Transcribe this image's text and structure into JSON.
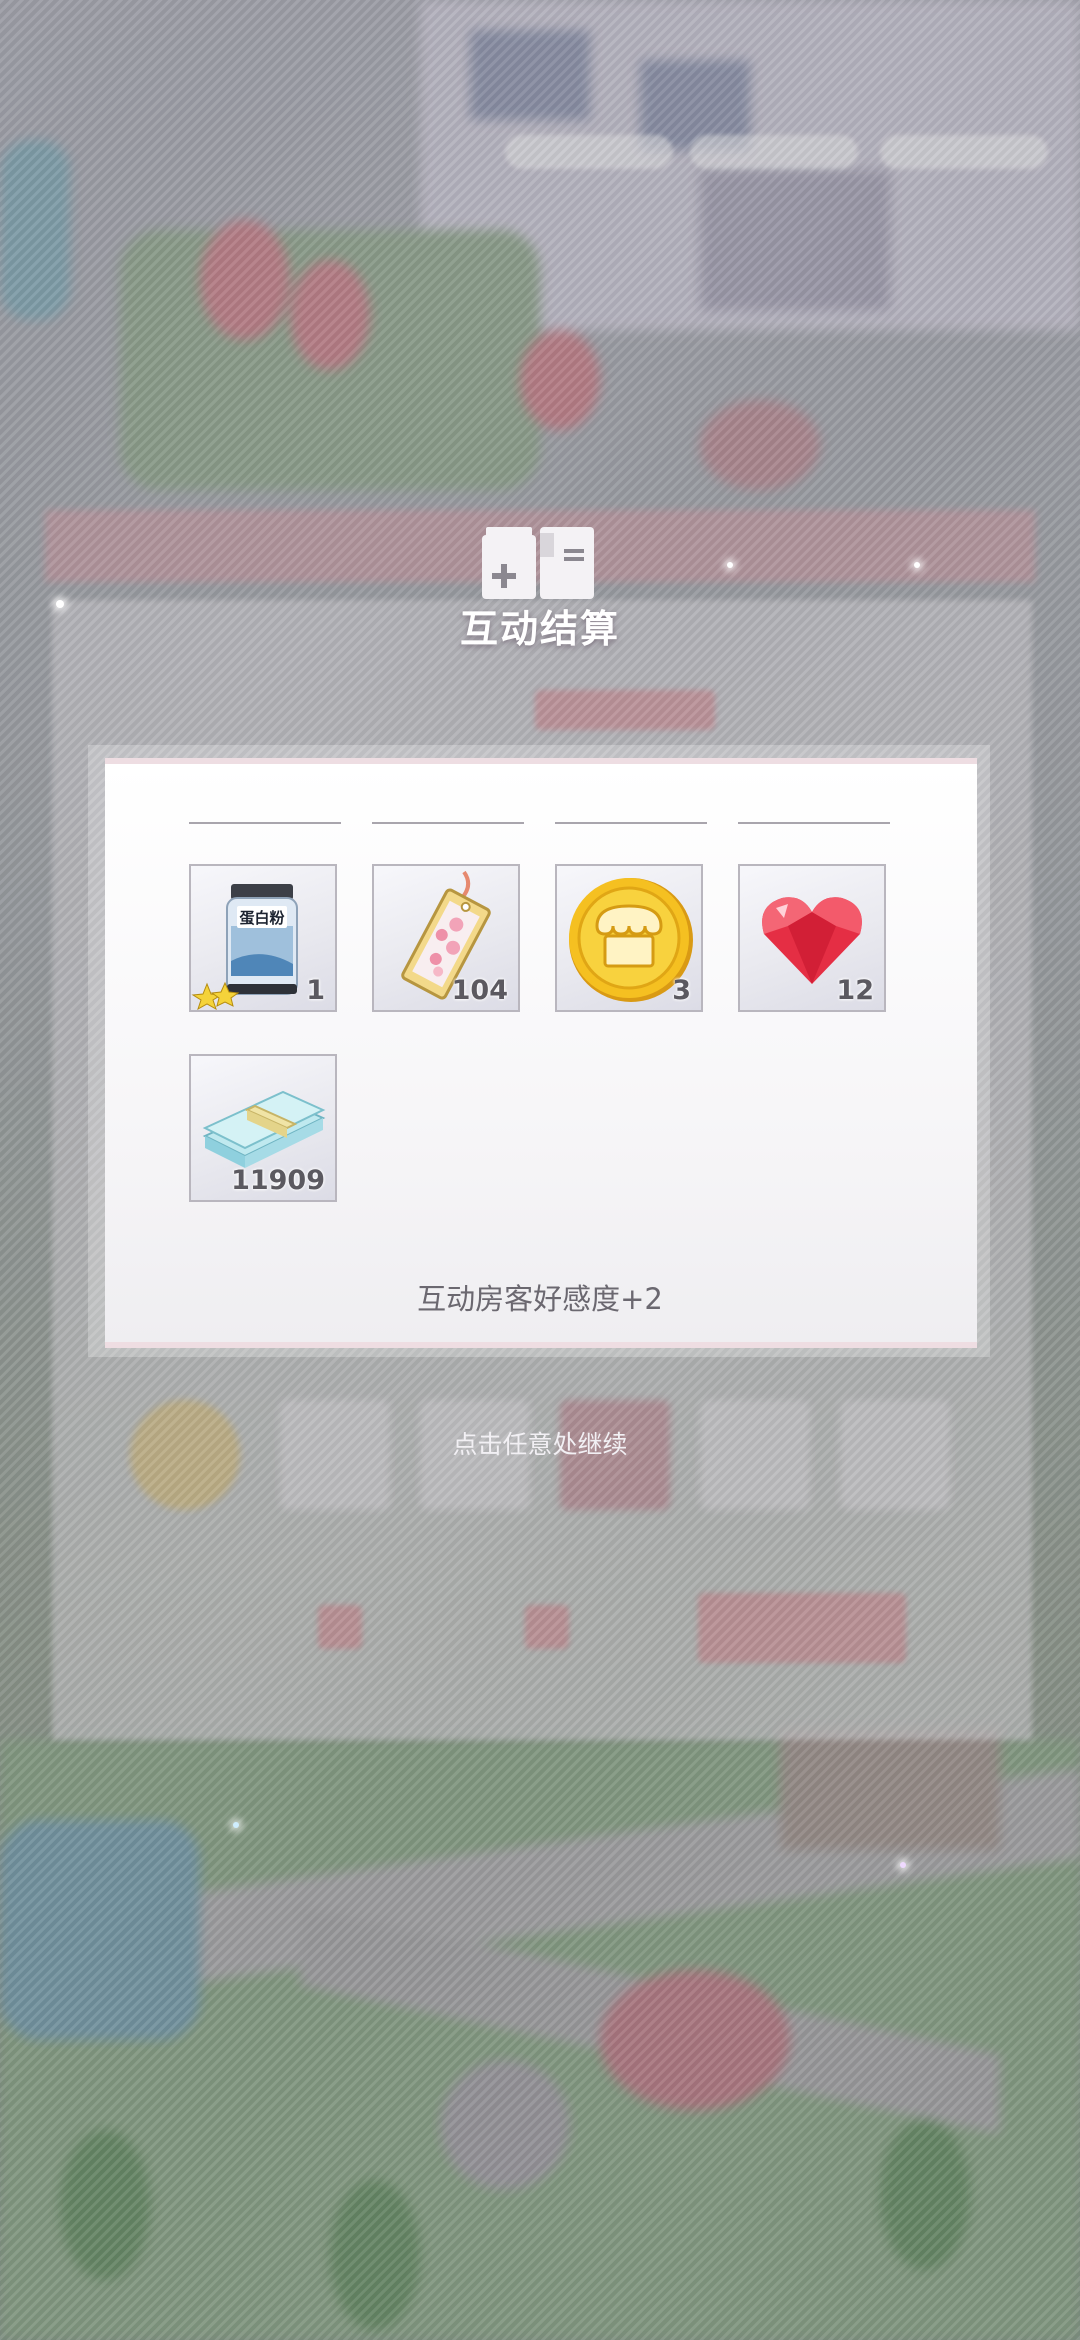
{
  "popup": {
    "title": "互动结算",
    "affinity_text": "互动房客好感度+2",
    "continue_hint": "点击任意处继续"
  },
  "rewards": [
    {
      "name": "protein-powder",
      "jar_label": "蛋白粉",
      "quantity": "1",
      "rarity_stars": 2
    },
    {
      "name": "sakura-bookmark",
      "quantity": "104"
    },
    {
      "name": "gold-shop-coin",
      "quantity": "3"
    },
    {
      "name": "red-heart-gem",
      "quantity": "12"
    },
    {
      "name": "cash-stack",
      "quantity": "11909"
    }
  ],
  "colors": {
    "title_text": "#ffffff",
    "qty_text": "#5b5960",
    "affinity_text": "#6b6870",
    "popup_border": "#eedde2"
  }
}
